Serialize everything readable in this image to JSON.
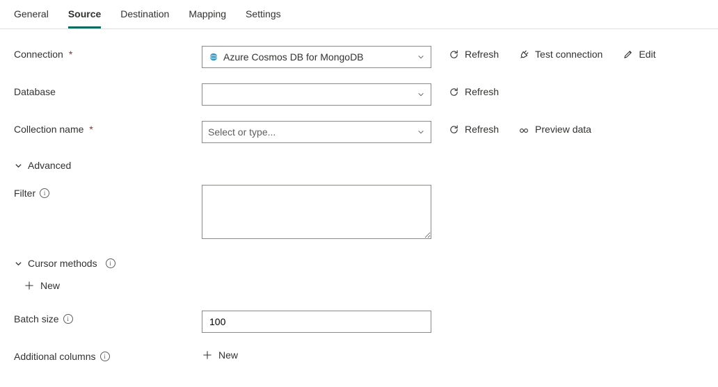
{
  "tabs": {
    "general": "General",
    "source": "Source",
    "destination": "Destination",
    "mapping": "Mapping",
    "settings": "Settings",
    "active": "source"
  },
  "labels": {
    "connection": "Connection",
    "database": "Database",
    "collection_name": "Collection name",
    "advanced": "Advanced",
    "filter": "Filter",
    "cursor_methods": "Cursor methods",
    "batch_size": "Batch size",
    "additional_columns": "Additional columns"
  },
  "values": {
    "connection": "Azure Cosmos DB for MongoDB",
    "database": "",
    "collection_name": "",
    "collection_placeholder": "Select or type...",
    "filter": "",
    "batch_size": "100"
  },
  "actions": {
    "refresh": "Refresh",
    "test_connection": "Test connection",
    "edit": "Edit",
    "preview_data": "Preview data",
    "new": "New"
  }
}
